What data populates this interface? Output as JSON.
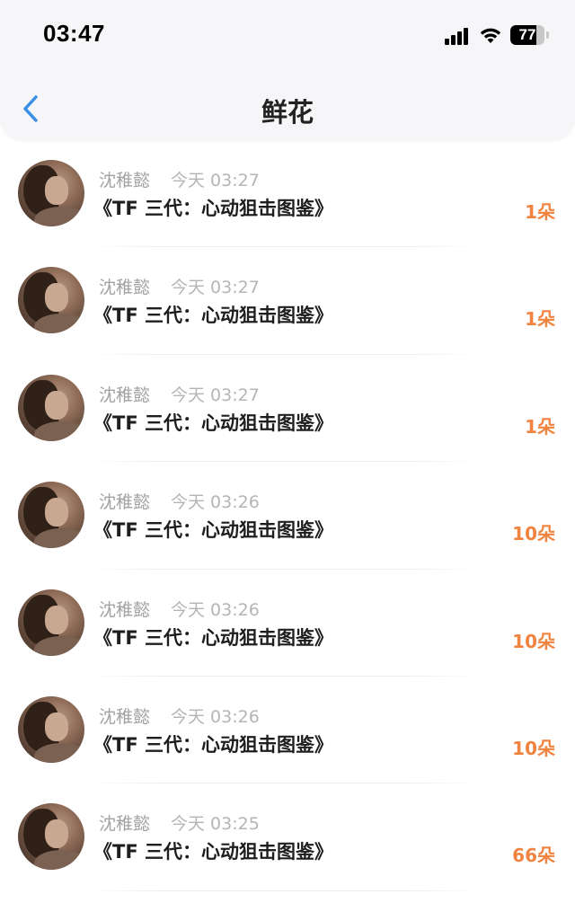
{
  "status_bar": {
    "time": "03:47",
    "battery": "77",
    "battery_level": 0.77
  },
  "header": {
    "title": "鲜花",
    "back_icon": "chevron-left-icon"
  },
  "colors": {
    "accent": "#3a8ee6",
    "count": "#f0833f"
  },
  "items": [
    {
      "user": "沈稚懿",
      "time": "今天 03:27",
      "title": "《TF 三代：心动狙击图鉴》",
      "count": "1朵"
    },
    {
      "user": "沈稚懿",
      "time": "今天 03:27",
      "title": "《TF 三代：心动狙击图鉴》",
      "count": "1朵"
    },
    {
      "user": "沈稚懿",
      "time": "今天 03:27",
      "title": "《TF 三代：心动狙击图鉴》",
      "count": "1朵"
    },
    {
      "user": "沈稚懿",
      "time": "今天 03:26",
      "title": "《TF 三代：心动狙击图鉴》",
      "count": "10朵"
    },
    {
      "user": "沈稚懿",
      "time": "今天 03:26",
      "title": "《TF 三代：心动狙击图鉴》",
      "count": "10朵"
    },
    {
      "user": "沈稚懿",
      "time": "今天 03:26",
      "title": "《TF 三代：心动狙击图鉴》",
      "count": "10朵"
    },
    {
      "user": "沈稚懿",
      "time": "今天 03:25",
      "title": "《TF 三代：心动狙击图鉴》",
      "count": "66朵"
    }
  ]
}
